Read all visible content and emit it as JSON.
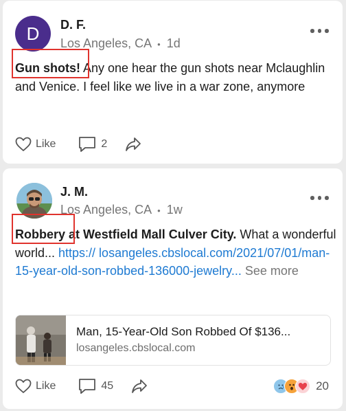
{
  "colors": {
    "accent": "#1e7ad2",
    "highlight": "#e0332d",
    "avatar_bg": "#4a2d8c"
  },
  "posts": [
    {
      "avatar_letter": "D",
      "author": "D. F.",
      "location": "Los Angeles, CA",
      "separator": "•",
      "time": "1d",
      "headline": "Gun shots!",
      "body": " Any one hear the gun shots near Mclaughlin and Venice. I feel like we live in a war zone, anymore",
      "actions": {
        "like_label": "Like",
        "comment_count": "2"
      }
    },
    {
      "author": "J. M.",
      "location": "Los Angeles, CA",
      "separator": "•",
      "time": "1w",
      "headline": "Robbery",
      "headline_rest": " at Westfield Mall Culver City.",
      "body": " What a wonderful world... ",
      "link": "https:// losangeles.cbslocal.com/2021/07/01/man-15-year-old-son-robbed-136000-jewelry...",
      "see_more": " See more",
      "preview": {
        "title": "Man, 15-Year-Old Son Robbed Of $136...",
        "domain": "losangeles.cbslocal.com"
      },
      "actions": {
        "like_label": "Like",
        "comment_count": "45",
        "reaction_count": "20"
      },
      "reaction_icons": [
        "sad-reaction-icon",
        "scared-reaction-icon",
        "heart-reaction-icon"
      ]
    }
  ]
}
